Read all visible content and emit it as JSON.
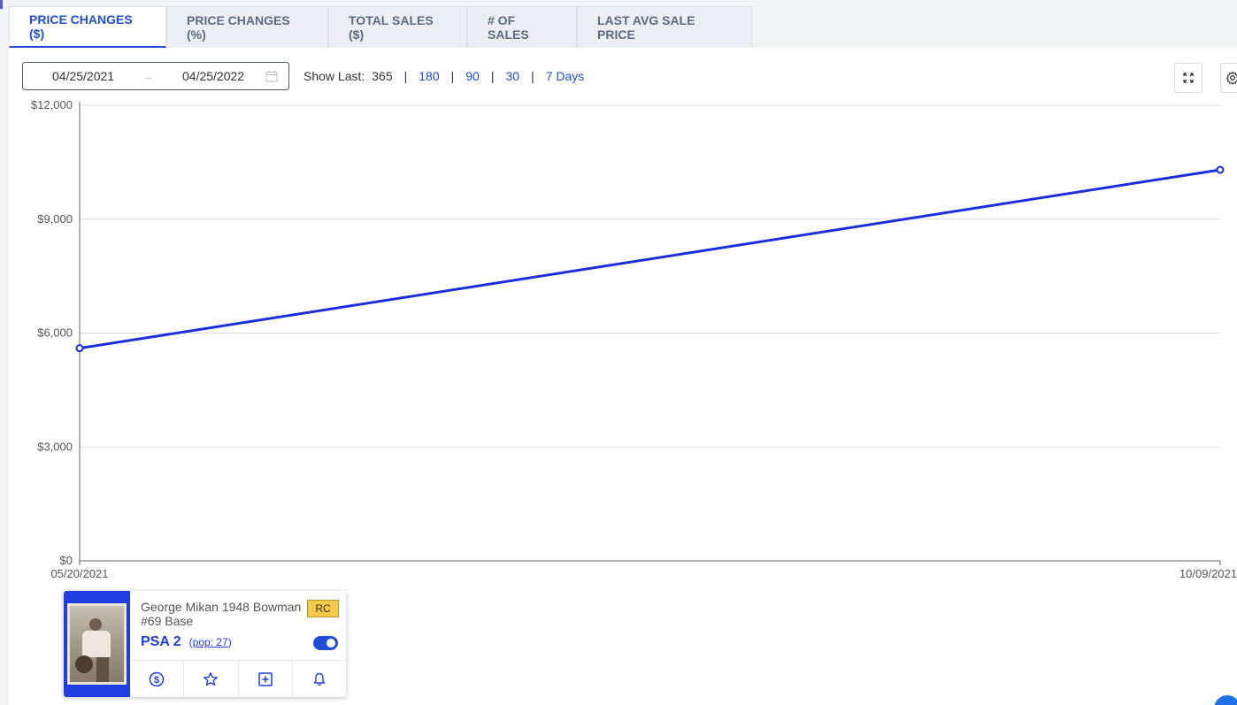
{
  "tabs": [
    {
      "label": "PRICE CHANGES ($)",
      "active": true
    },
    {
      "label": "PRICE CHANGES (%)",
      "active": false
    },
    {
      "label": "TOTAL SALES ($)",
      "active": false
    },
    {
      "label": "# OF SALES",
      "active": false
    },
    {
      "label": "LAST AVG SALE PRICE",
      "active": false
    }
  ],
  "controls": {
    "date_start": "04/25/2021",
    "date_arrow": "→",
    "date_end": "04/25/2022",
    "show_last_label": "Show Last:",
    "show_last_options": [
      "365",
      "180",
      "90",
      "30",
      "7 Days"
    ],
    "show_last_selected": "365",
    "separator": "|"
  },
  "colors": {
    "accent": "#1f4fd6",
    "line": "#1a2ee0",
    "grid": "#d9d9d9",
    "card_blue": "#1f3de0",
    "rc_badge": "#f7c948"
  },
  "chart_data": {
    "type": "line",
    "x": [
      "05/20/2021",
      "10/09/2021"
    ],
    "series": [
      {
        "values": [
          5600,
          10300
        ]
      }
    ],
    "y_ticks": [
      "$0",
      "$3,000",
      "$6,000",
      "$9,000",
      "$12,000"
    ],
    "y_tick_values": [
      0,
      3000,
      6000,
      9000,
      12000
    ],
    "ylim": [
      0,
      12000
    ],
    "x_tick_labels": [
      "05/20/2021",
      "10/09/2021"
    ],
    "grid": true
  },
  "card": {
    "name": "George Mikan 1948 Bowman #69 Base",
    "badge": "RC",
    "grade": "PSA 2",
    "pop_prefix": "(",
    "pop_link": "pop: 27",
    "pop_suffix": ")",
    "toggle_on": true,
    "actions": [
      "dollar-icon",
      "star-icon",
      "plus-square-icon",
      "bell-icon"
    ]
  }
}
